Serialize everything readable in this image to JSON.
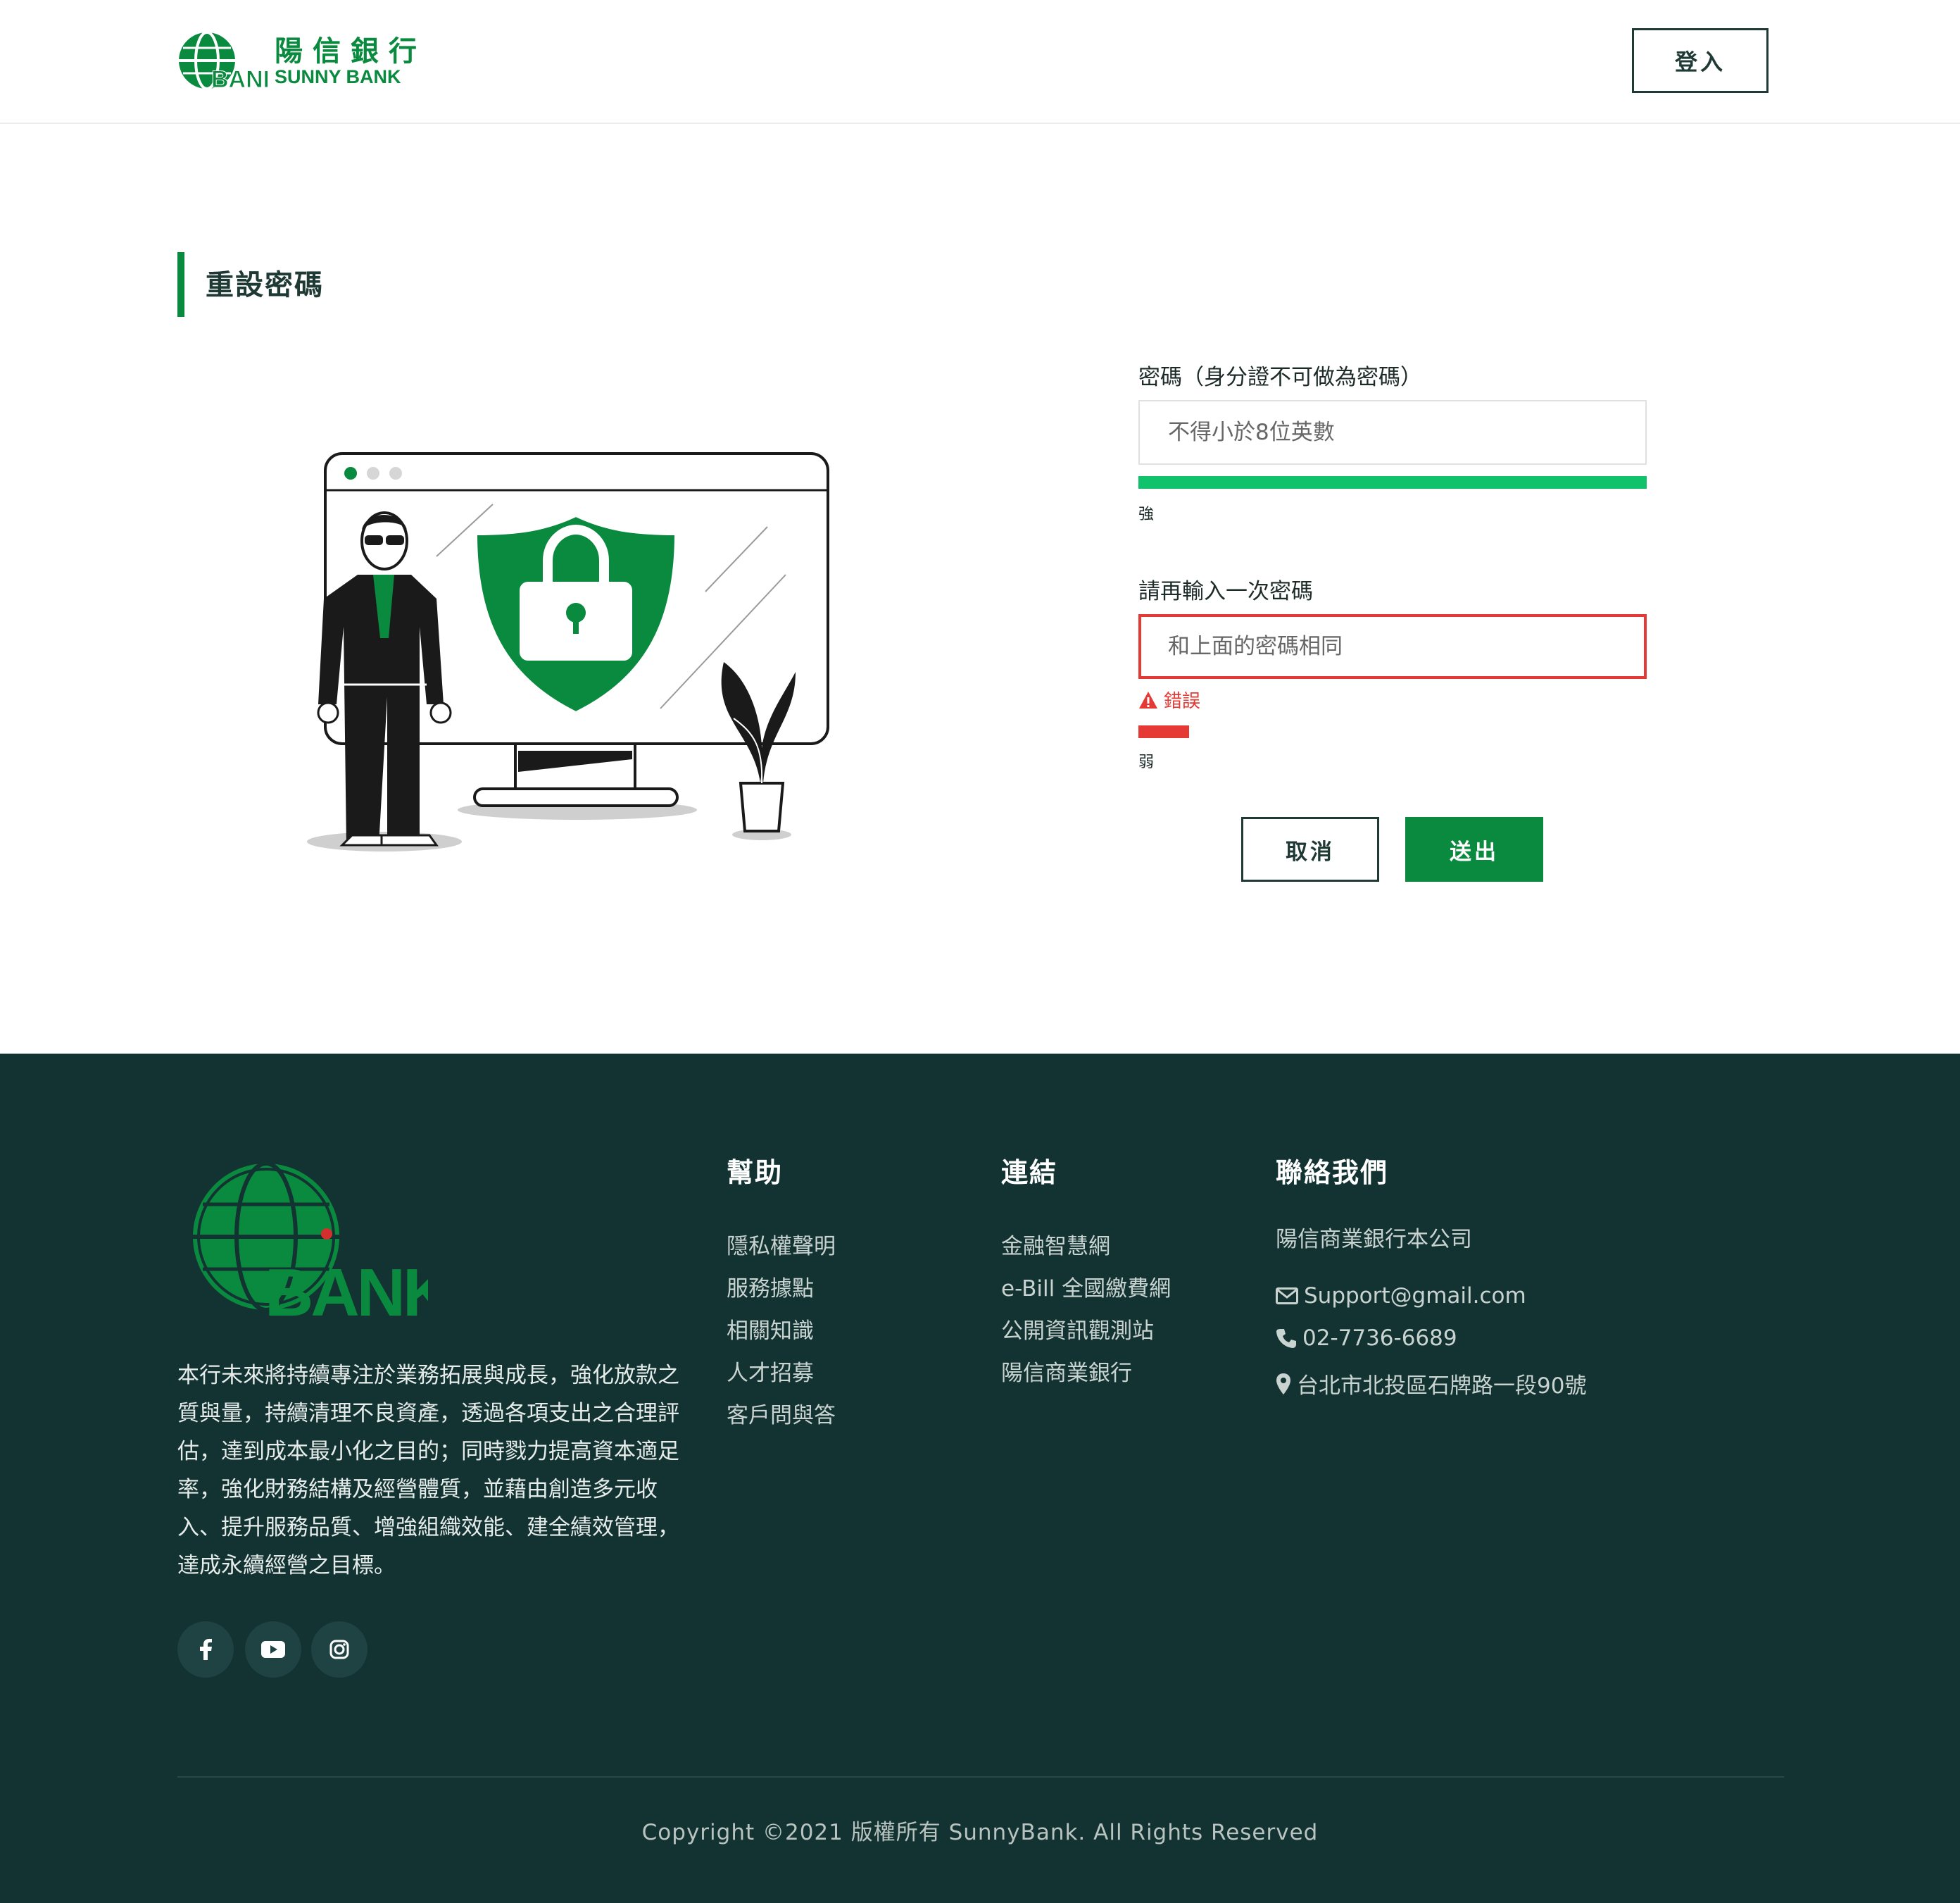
{
  "header": {
    "logo_zh": "陽信銀行",
    "logo_en": "SUNNY BANK",
    "login_label": "登入"
  },
  "page": {
    "title": "重設密碼"
  },
  "form": {
    "password_label": "密碼（身分證不可做為密碼）",
    "password_placeholder": "不得小於8位英數",
    "password_strength_text": "強",
    "password_strength": 1.0,
    "confirm_label": "請再輸入一次密碼",
    "confirm_placeholder": "和上面的密碼相同",
    "confirm_error": "錯誤",
    "confirm_strength_text": "弱",
    "confirm_strength": 0.1,
    "cancel_label": "取消",
    "submit_label": "送出"
  },
  "colors": {
    "brand_green": "#0a8a3e",
    "strength_strong": "#11c26d",
    "error_red": "#e53935",
    "footer_bg": "#133333"
  },
  "footer": {
    "logo_text": "SUNNY BANK",
    "description": "本行未來將持續專注於業務拓展與成長，強化放款之質與量，持續清理不良資產，透過各項支出之合理評估，達到成本最小化之目的；同時戮力提高資本適足率，強化財務結構及經營體質，並藉由創造多元收入、提升服務品質、增強組織效能、建全績效管理，達成永續經營之目標。",
    "social": [
      "facebook-icon",
      "youtube-icon",
      "instagram-icon"
    ],
    "help": {
      "heading": "幫助",
      "items": [
        "隱私權聲明",
        "服務據點",
        "相關知識",
        "人才招募",
        "客戶問與答"
      ]
    },
    "links": {
      "heading": "連結",
      "items": [
        "金融智慧網",
        "e-Bill 全國繳費網",
        "公開資訊觀測站",
        "陽信商業銀行"
      ]
    },
    "contact": {
      "heading": "聯絡我們",
      "company": "陽信商業銀行本公司",
      "email": "Support@gmail.com",
      "phone": "02-7736-6689",
      "address": "台北市北投區石牌路一段90號"
    },
    "copyright": "Copyright ©2021 版權所有 SunnyBank. All Rights Reserved"
  }
}
